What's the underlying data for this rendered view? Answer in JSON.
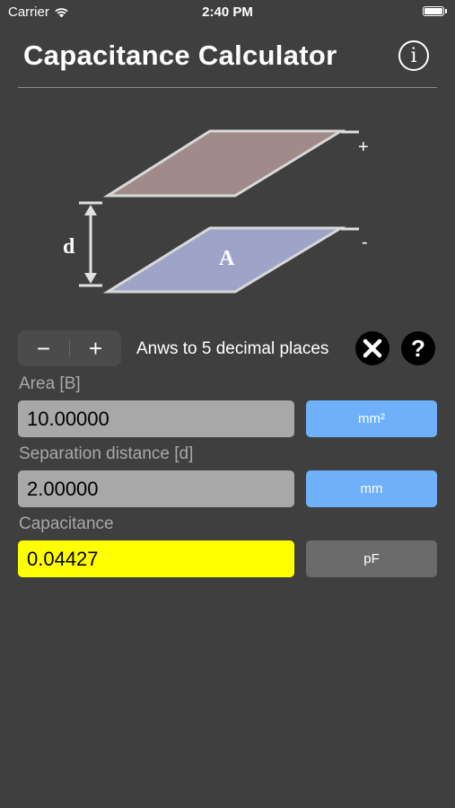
{
  "status_bar": {
    "carrier": "Carrier",
    "time": "2:40 PM"
  },
  "header": {
    "title": "Capacitance Calculator",
    "info_glyph": "i"
  },
  "diagram": {
    "plus_label": "+",
    "minus_label": "-",
    "distance_label": "d",
    "area_label": "A",
    "top_plate_color": "#a08a8a",
    "bottom_plate_color": "#9ea4c8"
  },
  "controls": {
    "decrement_label": "−",
    "increment_label": "+",
    "decimal_text": "Anws to 5 decimal places",
    "clear_icon": "close-icon",
    "help_label": "?"
  },
  "fields": {
    "area": {
      "label": "Area [B]",
      "value": "10.00000",
      "unit": "mm²"
    },
    "separation": {
      "label": "Separation distance [d]",
      "value": "2.00000",
      "unit": "mm"
    },
    "capacitance": {
      "label": "Capacitance",
      "value": "0.04427",
      "unit": "pF"
    }
  },
  "colors": {
    "background": "#3f3f3f",
    "unit_button_blue": "#6fb0fb",
    "result_highlight": "#ffff00"
  }
}
